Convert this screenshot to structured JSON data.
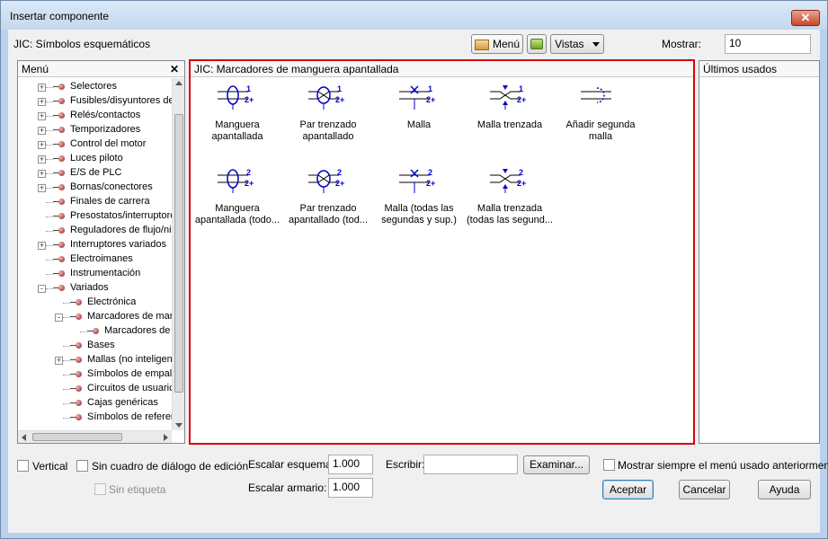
{
  "window": {
    "title": "Insertar componente",
    "close_glyph": "✕"
  },
  "library_label": "JIC: Símbolos esquemáticos",
  "toolbar": {
    "menu_label": "Menú",
    "views_label": "Vistas",
    "show_label": "Mostrar:",
    "show_value": "10"
  },
  "menu_panel": {
    "title": "Menú",
    "close_glyph": "✕"
  },
  "tree": [
    {
      "label": "Selectores",
      "level": 0,
      "expander": "+"
    },
    {
      "label": "Fusibles/disyuntores de",
      "level": 0,
      "expander": "+"
    },
    {
      "label": "Relés/contactos",
      "level": 0,
      "expander": "+"
    },
    {
      "label": "Temporizadores",
      "level": 0,
      "expander": "+"
    },
    {
      "label": "Control del motor",
      "level": 0,
      "expander": "+"
    },
    {
      "label": "Luces piloto",
      "level": 0,
      "expander": "+"
    },
    {
      "label": "E/S de PLC",
      "level": 0,
      "expander": "+"
    },
    {
      "label": "Bornas/conectores",
      "level": 0,
      "expander": "+"
    },
    {
      "label": "Finales de carrera",
      "level": 0,
      "expander": ""
    },
    {
      "label": "Presostatos/interruptore",
      "level": 0,
      "expander": ""
    },
    {
      "label": "Reguladores de flujo/ni",
      "level": 0,
      "expander": ""
    },
    {
      "label": "Interruptores variados",
      "level": 0,
      "expander": "+"
    },
    {
      "label": "Electroimanes",
      "level": 0,
      "expander": ""
    },
    {
      "label": "Instrumentación",
      "level": 0,
      "expander": ""
    },
    {
      "label": "Variados",
      "level": 0,
      "expander": "-"
    },
    {
      "label": "Electrónica",
      "level": 1,
      "expander": ""
    },
    {
      "label": "Marcadores de mar",
      "level": 1,
      "expander": "-"
    },
    {
      "label": "Marcadores de",
      "level": 2,
      "expander": ""
    },
    {
      "label": "Bases",
      "level": 1,
      "expander": ""
    },
    {
      "label": "Mallas (no inteligen",
      "level": 1,
      "expander": "+"
    },
    {
      "label": "Símbolos de empal",
      "level": 1,
      "expander": ""
    },
    {
      "label": "Circuitos de usuaric",
      "level": 1,
      "expander": ""
    },
    {
      "label": "Cajas genéricas",
      "level": 1,
      "expander": ""
    },
    {
      "label": "Símbolos de referer",
      "level": 1,
      "expander": ""
    }
  ],
  "symbols_panel": {
    "title": "JIC: Marcadores de manguera apantallada",
    "border_color": "#d9000d"
  },
  "symbols": [
    {
      "icon": "shielded-hose-1-icon",
      "caption_1": "Manguera",
      "caption_2": "apantallada"
    },
    {
      "icon": "shielded-twisted-pair-1-icon",
      "caption_1": "Par trenzado",
      "caption_2": "apantallado"
    },
    {
      "icon": "mesh-1-icon",
      "caption_1": "Malla",
      "caption_2": ""
    },
    {
      "icon": "twisted-mesh-1-icon",
      "caption_1": "Malla trenzada",
      "caption_2": ""
    },
    {
      "icon": "add-second-mesh-icon",
      "caption_1": "Añadir segunda",
      "caption_2": "malla"
    },
    {
      "icon": "shielded-hose-2-icon",
      "caption_1": "Manguera",
      "caption_2": "apantallada (todo..."
    },
    {
      "icon": "shielded-twisted-pair-2-icon",
      "caption_1": "Par trenzado",
      "caption_2": "apantallado (tod..."
    },
    {
      "icon": "mesh-2-icon",
      "caption_1": "Malla (todas las",
      "caption_2": "segundas y sup.)"
    },
    {
      "icon": "twisted-mesh-2-icon",
      "caption_1": "Malla trenzada",
      "caption_2": "(todas las segund..."
    }
  ],
  "recent_panel": {
    "title": "Últimos usados"
  },
  "options": {
    "vertical_label": "Vertical",
    "no_edit_dialog_label": "Sin cuadro de diálogo de edición",
    "no_tag_label": "Sin etiqueta",
    "scale_schematic_label": "Escalar esquema:",
    "scale_schematic_value": "1.000",
    "scale_panel_label": "Escalar armario:",
    "scale_panel_value": "1.000",
    "type_label": "Escribir:",
    "type_value": "",
    "browse_label": "Examinar...",
    "always_show_menu_label": "Mostrar siempre el menú usado anteriormente"
  },
  "buttons": {
    "ok": "Aceptar",
    "cancel": "Cancelar",
    "help": "Ayuda"
  },
  "colors": {
    "symbol_blue": "#0000cc",
    "selection_red": "#d9000d"
  }
}
